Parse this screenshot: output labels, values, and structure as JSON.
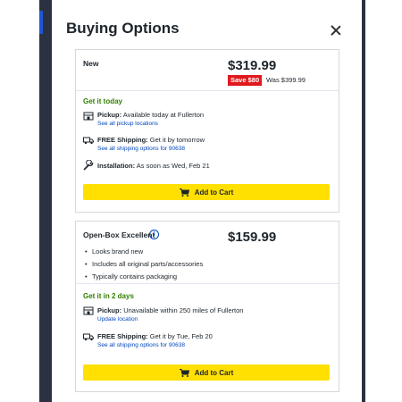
{
  "modal": {
    "title": "Buying Options",
    "close_icon": "close-icon"
  },
  "new_option": {
    "label": "New",
    "price": "$319.99",
    "save_badge": "Save $80",
    "was_price": "Was $399.99",
    "availability_heading": "Get it today",
    "pickup": {
      "label": "Pickup:",
      "text": "Available today at Fullerton",
      "link": "See all pickup locations",
      "icon": "store-pickup-icon"
    },
    "shipping": {
      "label": "FREE Shipping:",
      "text": "Get it by tomorrow",
      "link": "See all shipping options for 90638",
      "icon": "truck-icon"
    },
    "installation": {
      "label": "Installation:",
      "text": "As soon as Wed, Feb 21",
      "icon": "wrench-icon"
    },
    "cart_button": "Add to Cart"
  },
  "open_box_option": {
    "label": "Open-Box Excellent",
    "info_icon": "info-icon",
    "price": "$159.99",
    "bullets": [
      "Looks brand new",
      "Includes all original parts/accessories",
      "Typically contains packaging"
    ],
    "availability_heading": "Get it in 2 days",
    "pickup": {
      "label": "Pickup:",
      "text": "Unavailable within 250 miles of Fullerton",
      "link": "Update location",
      "icon": "store-pickup-icon"
    },
    "shipping": {
      "label": "FREE Shipping:",
      "text": "Get it by Tue, Feb 20",
      "link": "See all shipping options for 90638",
      "icon": "truck-icon"
    },
    "cart_button": "Add to Cart"
  },
  "colors": {
    "cart_button": "#ffe000",
    "save_badge": "#e0191e",
    "availability_green": "#318000",
    "link_blue": "#0046be"
  }
}
